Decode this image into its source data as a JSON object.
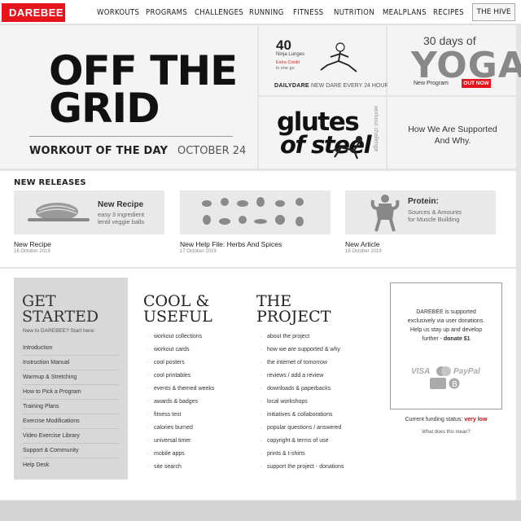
{
  "nav": {
    "logo": "DAREBEE",
    "items": [
      "WORKOUTS",
      "PROGRAMS",
      "CHALLENGES",
      "RUNNING",
      "FITNESS",
      "NUTRITION",
      "MEALPLANS",
      "RECIPES"
    ],
    "hive": "THE HIVE"
  },
  "hero": {
    "title_line1": "OFF THE",
    "title_line2": "GRID",
    "label": "WORKOUT OF THE DAY",
    "date": "OCTOBER 24"
  },
  "daily": {
    "number": "40",
    "exercise": "Ninja Lunges",
    "credit": "Extra Credit",
    "credit_note": "in one go",
    "label": "DAILYDARE",
    "tagline": "NEW DARE EVERY 24 HOURS"
  },
  "yoga": {
    "days": "30 days of",
    "title": "YOGA",
    "program": "New Program",
    "badge": "OUT NOW"
  },
  "glutes": {
    "line1": "glutes",
    "line2": "of steel",
    "side": "workout challenge"
  },
  "support_tile": {
    "line1": "How We Are Supported",
    "line2": "And Why."
  },
  "new_releases": {
    "heading": "NEW RELEASES",
    "items": [
      {
        "title": "New Recipe",
        "date": "16 October 2019",
        "img_heading": "New Recipe",
        "img_sub1": "easy 3 ingredient",
        "img_sub2": "lentil veggie balls"
      },
      {
        "title": "New Help File: Herbs And Spices",
        "date": "17 October 2019"
      },
      {
        "title": "New Article",
        "date": "16 October 2019",
        "img_heading": "Protein:",
        "img_sub1": "Sources & Amounts",
        "img_sub2": "for Muscle Building"
      }
    ]
  },
  "get_started": {
    "title1": "GET",
    "title2": "STARTED",
    "subtitle": "New to DAREBEE? Start here:",
    "items": [
      "Introduction",
      "Instruction Manual",
      "Warmup & Stretching",
      "How to Pick a Program",
      "Training Plans",
      "Exercise Modifications",
      "Video Exercise Library",
      "Support & Community",
      "Help Desk"
    ]
  },
  "cool": {
    "title1": "COOL &",
    "title2": "USEFUL",
    "items": [
      "workout collections",
      "workout cards",
      "cool posters",
      "cool printables",
      "events & themed weeks",
      "awards & badges",
      "fitness test",
      "calories burned",
      "universal timer",
      "mobile apps",
      "site search"
    ]
  },
  "project": {
    "title1": "THE",
    "title2": "PROJECT",
    "items": [
      "about the project",
      "how we are supported & why",
      "the internet of tomorrow",
      "reviews / add a review",
      "downloads & paperbacks",
      "local workshops",
      "initiatives & collaborations",
      "popular questions / answered",
      "copyright & terms of use",
      "prints & t-shirts",
      "support the project - donations"
    ]
  },
  "donate": {
    "line1": "DAREBEE is supported",
    "line2": "exclusively via user donations.",
    "line3": "Help us stay up and develop",
    "line4_pre": "further - ",
    "line4_link": "donate $1",
    "visa": "VISA",
    "paypal": "PayPal",
    "funding_label": "Current funding status: ",
    "funding_value": "very low",
    "question": "What does this mean?"
  }
}
